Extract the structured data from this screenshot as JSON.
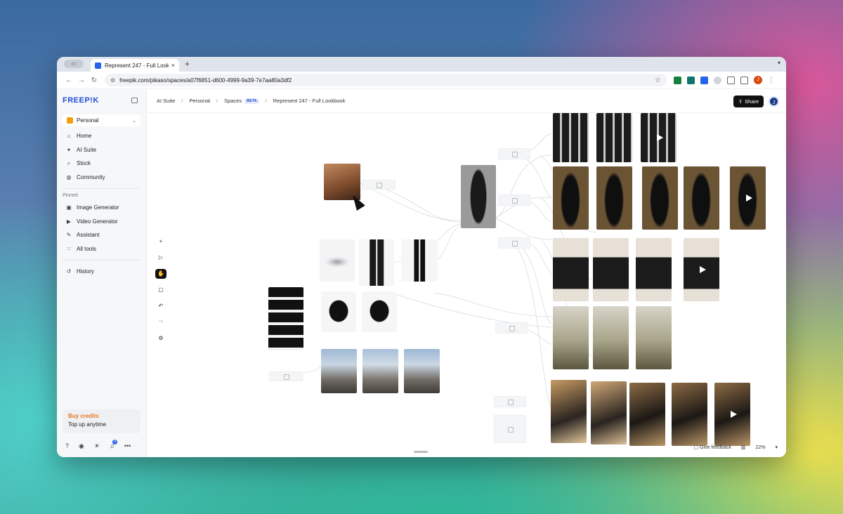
{
  "browser": {
    "tab_title": "Represent 247 - Full Lookbook",
    "tab_close": "×",
    "new_tab": "+",
    "url": "freepik.com/pikaso/spaces/a07f6851-d600-4999-9a39-7e7aa80a3df2",
    "profile_initial": "J"
  },
  "sidebar": {
    "logo": "FREEP!K",
    "workspace": "Personal",
    "nav": [
      {
        "label": "Home",
        "icon": "home-icon"
      },
      {
        "label": "AI Suite",
        "icon": "sparkle-icon"
      },
      {
        "label": "Stock",
        "icon": "search-icon"
      },
      {
        "label": "Community",
        "icon": "globe-icon"
      }
    ],
    "pinned_label": "Pinned",
    "pinned": [
      {
        "label": "Image Generator",
        "icon": "image-icon"
      },
      {
        "label": "Video Generator",
        "icon": "video-icon"
      },
      {
        "label": "Assistant",
        "icon": "chat-icon"
      },
      {
        "label": "All tools",
        "icon": "grid-icon"
      }
    ],
    "history": "History",
    "credits_title": "Buy credits",
    "credits_sub": "Top up anytime",
    "notification_count": "9"
  },
  "breadcrumb": {
    "items": [
      "AI Suite",
      "Personal",
      "Spaces",
      "Represent 247 - Full Lookbook"
    ],
    "beta": "BETA"
  },
  "header": {
    "share_label": "Share",
    "avatar_initial": "J"
  },
  "canvas": {
    "feedback_label": "Give feedback",
    "zoom": "22%"
  },
  "colors": {
    "brand": "#1d4ed8",
    "credits": "#e8771a",
    "share_bg": "#111111"
  }
}
